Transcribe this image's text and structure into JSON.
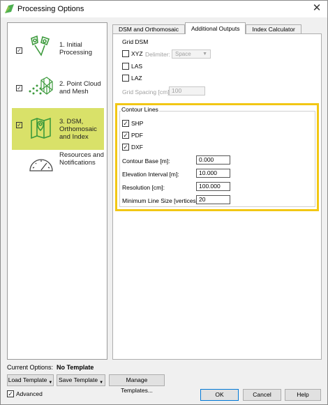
{
  "window": {
    "title": "Processing Options",
    "close_symbol": "✕"
  },
  "nav": {
    "items": [
      {
        "label_line1": "1. Initial",
        "label_line2": "Processing",
        "label_line3": "",
        "checked": true
      },
      {
        "label_line1": "2. Point Cloud",
        "label_line2": "and Mesh",
        "label_line3": "",
        "checked": true
      },
      {
        "label_line1": "3. DSM,",
        "label_line2": "Orthomosaic",
        "label_line3": "and Index",
        "checked": true,
        "selected": true
      },
      {
        "label_line1": "Resources and",
        "label_line2": "Notifications",
        "label_line3": "",
        "checked": false
      }
    ]
  },
  "tabs": [
    {
      "label": "DSM and Orthomosaic"
    },
    {
      "label": "Additional Outputs",
      "active": true
    },
    {
      "label": "Index Calculator"
    }
  ],
  "grid_dsm": {
    "title": "Grid DSM",
    "xyz": "XYZ",
    "delimiter_label": "Delimiter:",
    "delimiter_value": "Space",
    "las": "LAS",
    "laz": "LAZ",
    "spacing_label": "Grid Spacing [cm]:",
    "spacing_value": "100"
  },
  "contour": {
    "title": "Contour Lines",
    "shp": "SHP",
    "pdf": "PDF",
    "dxf": "DXF",
    "base_label": "Contour Base [m]:",
    "base_value": "0.000",
    "interval_label": "Elevation Interval [m]:",
    "interval_value": "10.000",
    "resolution_label": "Resolution [cm]:",
    "resolution_value": "100.000",
    "minsize_label": "Minimum Line Size [vertices]:",
    "minsize_value": "20"
  },
  "bottom": {
    "current_options_label": "Current Options:",
    "current_options_value": "No Template",
    "load_template": "Load Template",
    "save_template": "Save Template",
    "manage_templates": "Manage Templates...",
    "advanced": "Advanced",
    "ok": "OK",
    "cancel": "Cancel",
    "help": "Help"
  },
  "colors": {
    "accent": "#d9e169",
    "highlight": "#f2c714",
    "icon_green": "#3c9a3c"
  }
}
